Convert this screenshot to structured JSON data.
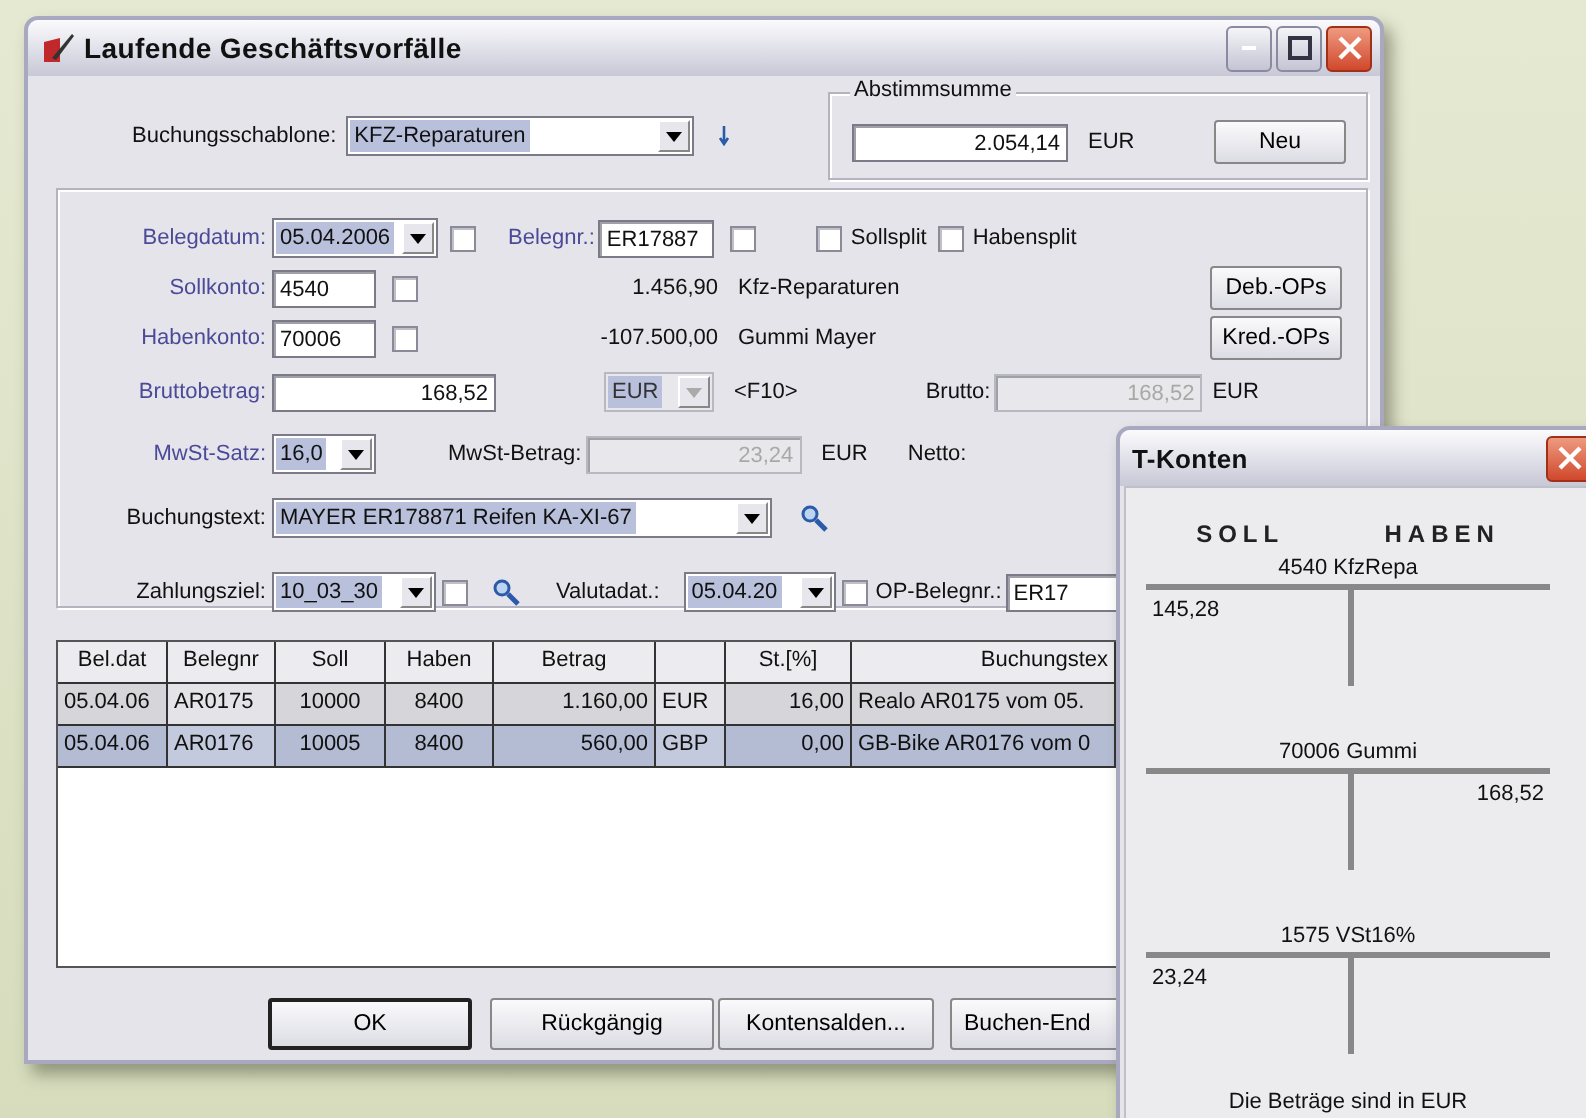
{
  "window": {
    "title": "Laufende Geschäftsvorfälle"
  },
  "template": {
    "label": "Buchungsschablone:",
    "value": "KFZ-Reparaturen"
  },
  "balance": {
    "legend": "Abstimmsumme",
    "value": "2.054,14",
    "currency": "EUR",
    "button": "Neu"
  },
  "document": {
    "date_label": "Belegdatum:",
    "date": "05.04.2006",
    "date_checked": false,
    "number_label": "Belegnr.:",
    "number": "ER17887",
    "number_checked": false,
    "splits": [
      {
        "label": "Sollsplit",
        "checked": false
      },
      {
        "label": "Habensplit",
        "checked": false
      }
    ]
  },
  "accounts": [
    {
      "label": "Sollkonto:",
      "value": "4540",
      "checked": false,
      "balance": "1.456,90",
      "name": "Kfz-Reparaturen",
      "button": "Deb.-OPs"
    },
    {
      "label": "Habenkonto:",
      "value": "70006",
      "checked": false,
      "balance": "-107.500,00",
      "name": "Gummi Mayer",
      "button": "Kred.-OPs"
    }
  ],
  "gross": {
    "label": "Bruttobetrag:",
    "value": "168,52",
    "currency": "EUR",
    "currency_disabled": true,
    "hotkey": "<F10>",
    "brutto_label": "Brutto:",
    "brutto": "168,52",
    "brutto_disabled": true,
    "brutto_currency": "EUR"
  },
  "vat": {
    "label": "MwSt-Satz:",
    "rate": "16,0",
    "amount_label": "MwSt-Betrag:",
    "amount": "23,24",
    "amount_disabled": true,
    "currency": "EUR",
    "netto_label": "Netto:"
  },
  "text": {
    "label": "Buchungstext:",
    "value": "MAYER ER178871 Reifen KA-XI-67"
  },
  "payment": {
    "label": "Zahlungsziel:",
    "value": "10_03_30",
    "checked": false,
    "value_date_label": "Valutadat.:",
    "value_date": "05.04.20",
    "value_date_checked": false,
    "op_label": "OP-Belegnr.:",
    "op_value": "ER17"
  },
  "table": {
    "columns": [
      "Bel.dat",
      "Belegnr",
      "Soll",
      "Haben",
      "Betrag",
      "",
      "St.[%]",
      "Buchungstex"
    ],
    "rows": [
      {
        "cells": [
          "05.04.06",
          "AR0175",
          "10000",
          "8400",
          "1.160,00",
          "EUR",
          "16,00",
          "Realo AR0175 vom 05."
        ],
        "selected": false
      },
      {
        "cells": [
          "05.04.06",
          "AR0176",
          "10005",
          "8400",
          "560,00",
          "GBP",
          "0,00",
          "GB-Bike AR0176 vom 0"
        ],
        "selected": true
      }
    ]
  },
  "buttons": [
    "OK",
    "Rückgängig",
    "Kontensalden...",
    "Buchen-End"
  ],
  "t_accounts": {
    "title": "T-Konten",
    "soll_heading": "SOLL",
    "haben_heading": "HABEN",
    "accounts": [
      {
        "title": "4540 KfzRepa",
        "soll": "145,28"
      },
      {
        "title": "70006 Gummi",
        "haben": "168,52"
      },
      {
        "title": "1575 VSt16%",
        "soll": "23,24"
      }
    ],
    "footer": "Die Beträge sind in EUR"
  }
}
